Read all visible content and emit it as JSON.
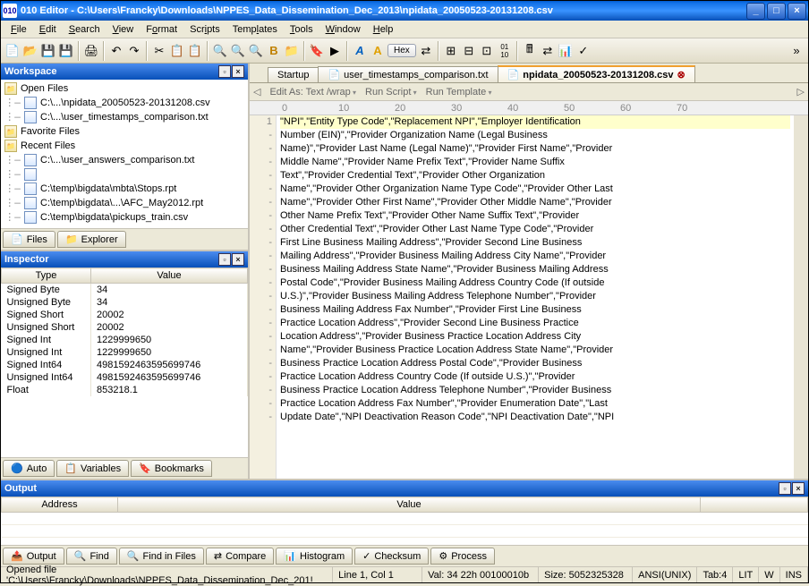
{
  "title": "010 Editor - C:\\Users\\Francky\\Downloads\\NPPES_Data_Dissemination_Dec_2013\\npidata_20050523-20131208.csv",
  "menu": [
    "File",
    "Edit",
    "Search",
    "View",
    "Format",
    "Scripts",
    "Templates",
    "Tools",
    "Window",
    "Help"
  ],
  "hex_label": "Hex",
  "workspace": {
    "title": "Workspace",
    "groups": [
      {
        "label": "Open Files",
        "items": [
          "C:\\...\\npidata_20050523-20131208.csv",
          "C:\\...\\user_timestamps_comparison.txt"
        ]
      },
      {
        "label": "Favorite Files",
        "items": []
      },
      {
        "label": "Recent Files",
        "items": [
          "C:\\...\\user_answers_comparison.txt",
          "",
          "C:\\temp\\bigdata\\mbta\\Stops.rpt",
          "C:\\temp\\bigdata\\...\\AFC_May2012.rpt",
          "C:\\temp\\bigdata\\pickups_train.csv"
        ]
      }
    ],
    "tabs": [
      "Files",
      "Explorer"
    ]
  },
  "inspector": {
    "title": "Inspector",
    "columns": [
      "Type",
      "Value"
    ],
    "rows": [
      [
        "Signed Byte",
        "34"
      ],
      [
        "Unsigned Byte",
        "34"
      ],
      [
        "Signed Short",
        "20002"
      ],
      [
        "Unsigned Short",
        "20002"
      ],
      [
        "Signed Int",
        "1229999650"
      ],
      [
        "Unsigned Int",
        "1229999650"
      ],
      [
        "Signed Int64",
        "4981592463595699746"
      ],
      [
        "Unsigned Int64",
        "4981592463595699746"
      ],
      [
        "Float",
        "853218.1"
      ]
    ],
    "tabs": [
      "Auto",
      "Variables",
      "Bookmarks"
    ]
  },
  "tabs": [
    {
      "label": "Startup",
      "active": false
    },
    {
      "label": "user_timestamps_comparison.txt",
      "active": false
    },
    {
      "label": "npidata_20050523-20131208.csv",
      "active": true
    }
  ],
  "subbar": {
    "edit_as": "Edit As: Text /wrap",
    "run_script": "Run Script",
    "run_template": "Run Template"
  },
  "ruler": [
    "0",
    "10",
    "20",
    "30",
    "40",
    "50",
    "60",
    "70"
  ],
  "first_line_no": "1",
  "code_lines": [
    "\"NPI\",\"Entity Type Code\",\"Replacement NPI\",\"Employer Identification",
    "Number (EIN)\",\"Provider Organization Name (Legal Business",
    "Name)\",\"Provider Last Name (Legal Name)\",\"Provider First Name\",\"Provider",
    "Middle Name\",\"Provider Name Prefix Text\",\"Provider Name Suffix",
    "Text\",\"Provider Credential Text\",\"Provider Other Organization",
    "Name\",\"Provider Other Organization Name Type Code\",\"Provider Other Last",
    "Name\",\"Provider Other First Name\",\"Provider Other Middle Name\",\"Provider",
    "Other Name Prefix Text\",\"Provider Other Name Suffix Text\",\"Provider",
    "Other Credential Text\",\"Provider Other Last Name Type Code\",\"Provider",
    "First Line Business Mailing Address\",\"Provider Second Line Business",
    "Mailing Address\",\"Provider Business Mailing Address City Name\",\"Provider",
    "Business Mailing Address State Name\",\"Provider Business Mailing Address",
    "Postal Code\",\"Provider Business Mailing Address Country Code (If outside",
    "U.S.)\",\"Provider Business Mailing Address Telephone Number\",\"Provider",
    "Business Mailing Address Fax Number\",\"Provider First Line Business",
    "Practice Location Address\",\"Provider Second Line Business Practice",
    "Location Address\",\"Provider Business Practice Location Address City",
    "Name\",\"Provider Business Practice Location Address State Name\",\"Provider",
    "Business Practice Location Address Postal Code\",\"Provider Business",
    "Practice Location Address Country Code (If outside U.S.)\",\"Provider",
    "Business Practice Location Address Telephone Number\",\"Provider Business",
    "Practice Location Address Fax Number\",\"Provider Enumeration Date\",\"Last",
    "Update Date\",\"NPI Deactivation Reason Code\",\"NPI Deactivation Date\",\"NPI"
  ],
  "output": {
    "title": "Output",
    "columns": [
      "Address",
      "Value"
    ],
    "tabs": [
      "Output",
      "Find",
      "Find in Files",
      "Compare",
      "Histogram",
      "Checksum",
      "Process"
    ]
  },
  "status": {
    "file": "Opened file 'C:\\Users\\Francky\\Downloads\\NPPES_Data_Dissemination_Dec_201!",
    "pos": "Line 1, Col 1",
    "val": "Val: 34 22h 00100010b",
    "size": "Size: 5052325328",
    "enc": "ANSI(UNIX)",
    "tab": "Tab:4",
    "lit": "LIT",
    "w": "W",
    "ins": "INS"
  }
}
